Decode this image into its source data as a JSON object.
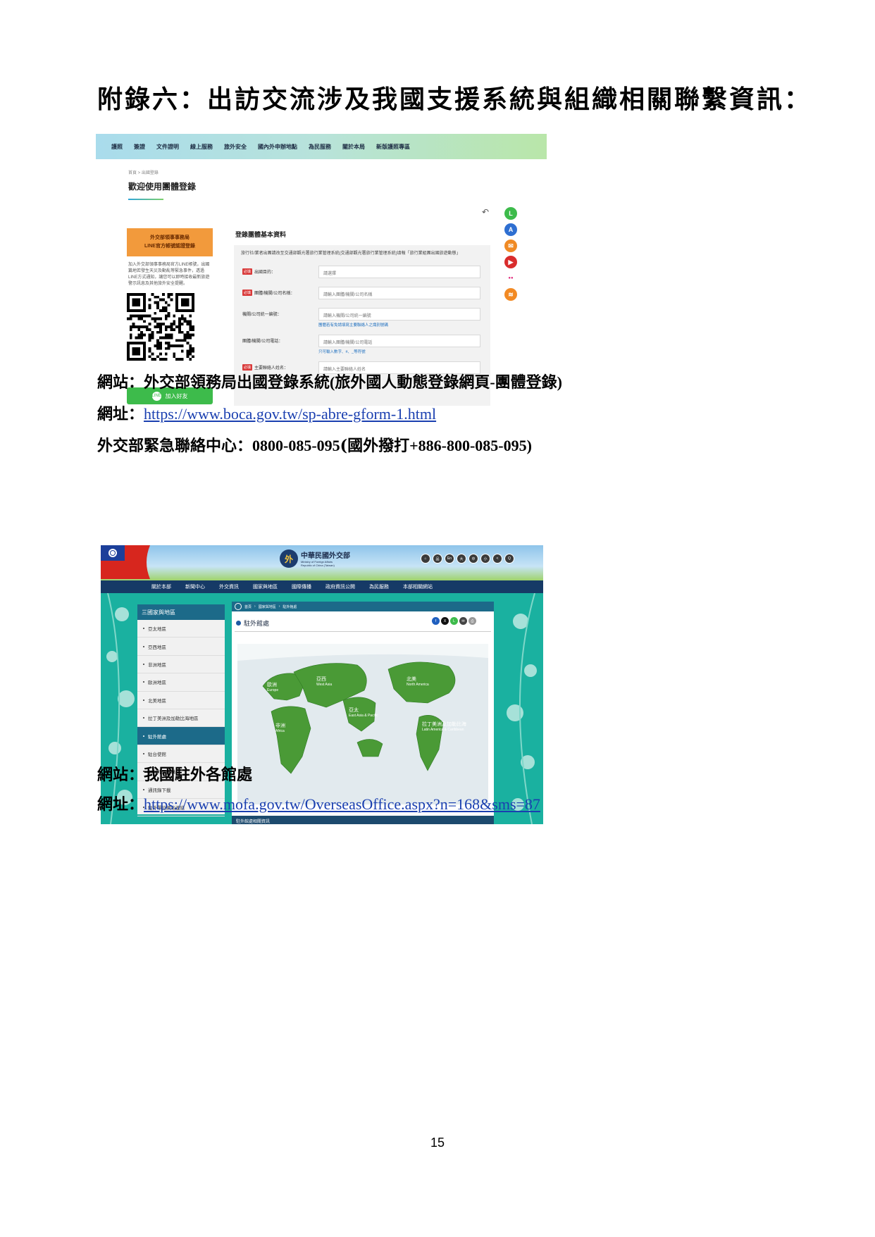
{
  "heading": "附錄六：出訪交流涉及我國支援系統與組織相關聯繫資訊：",
  "screenshot1": {
    "nav": [
      "護照",
      "簽證",
      "文件證明",
      "線上服務",
      "旅外安全",
      "國內外申辦地點",
      "為民服務",
      "關於本局",
      "新版護照專區"
    ],
    "breadcrumb": "首頁 > 出國登錄",
    "title": "歡迎使用團體登錄",
    "orange_box": [
      "外交部領事事務局",
      "LINE官方帳號認證登錄"
    ],
    "desc": "加入外交部領事事務局官方LINE帳號，出國篇地若發生天災及動亂等緊急事件，透過LINE方式通知，讓您可以即時接收最新旅遊警示訊息及其他旅外安全提醒。",
    "line_button": "加入好友",
    "form_title": "登錄團體基本資料",
    "form_note": "旅行社/業者出團請改至交通部觀光署旅行業管理系統(交通部觀光署旅行業管理系統)填報「旅行業組團出國旅遊動態」",
    "required_tag": "必填",
    "rows": [
      {
        "label": "出國目的：",
        "required": true,
        "value": "請選擇",
        "hint": ""
      },
      {
        "label": "團體/機關/公司名稱：",
        "required": true,
        "value": "請輸入團體/機關/公司名稱",
        "hint": ""
      },
      {
        "label": "機關/公司統一編號：",
        "required": false,
        "value": "請輸入機關/公司統一編號",
        "hint": "團體若有免請填寫主要聯絡人之識別號碼"
      },
      {
        "label": "團體/機關/公司電話：",
        "required": false,
        "value": "請輸入團體/機關/公司電話",
        "hint": "只可輸入數字、#、_等符號"
      },
      {
        "label": "主要聯絡人姓名：",
        "required": true,
        "value": "請輸入主要聯絡人姓名",
        "hint": ""
      }
    ],
    "socials": [
      {
        "icon": "line-icon",
        "color": "#3dbb4b",
        "glyph": "L"
      },
      {
        "icon": "share-icon",
        "color": "#2e6fd1",
        "glyph": "A"
      },
      {
        "icon": "mail-icon",
        "color": "#f08a24",
        "glyph": "✉"
      },
      {
        "icon": "youtube-icon",
        "color": "#d92c2c",
        "glyph": "▶"
      },
      {
        "icon": "flickr-icon",
        "color": "#ffffff",
        "glyph": "●●"
      },
      {
        "icon": "rss-icon",
        "color": "#f28a24",
        "glyph": "≋"
      }
    ]
  },
  "caption1": {
    "label": "網站：",
    "text": "外交部領務局出國登錄系統",
    "paren": "(旅外國人動態登錄網頁-團體登錄)"
  },
  "url1": {
    "label": "網址：",
    "href": "https://www.boca.gov.tw/sp-abre-gform-1.html"
  },
  "emergency": {
    "label": "外交部緊急聯絡中心：",
    "number": "0800-085-095",
    "abroad_open": "(國外撥打",
    "abroad_number": "+886-800-085-095)"
  },
  "screenshot2": {
    "logo_zh": "中華民國外交部",
    "logo_en1": "Ministry of Foreign Affairs",
    "logo_en2": "Republic of China (Taiwan)",
    "top_icons": [
      "⌂",
      "品",
      "En",
      "大",
      "中",
      "小",
      "<",
      "Q"
    ],
    "nav": [
      "關於本部",
      "新聞中心",
      "外交資訊",
      "國家與地區",
      "國際傳播",
      "政府資訊公開",
      "為民服務",
      "本部相關網站"
    ],
    "side_title": "三國家與地區",
    "side_items": [
      "亞太地區",
      "亞西地區",
      "非洲地區",
      "歐洲地區",
      "北美地區",
      "拉丁美洲及加勒比海地區",
      "駐外館處",
      "駐台使館",
      "駐台外國機構",
      "通訊錄下載",
      "駐外單位網站連結"
    ],
    "side_active_index": 6,
    "breadcrumb": [
      "首頁",
      "國家與地區",
      "駐外館處"
    ],
    "page_title": "駐外館處",
    "map_labels": [
      {
        "zh": "亞西",
        "en": "West Asia"
      },
      {
        "zh": "歐洲",
        "en": "Europe"
      },
      {
        "zh": "非洲",
        "en": "Africa"
      },
      {
        "zh": "亞太",
        "en": "East Asia & Pacific"
      },
      {
        "zh": "北美",
        "en": "North America"
      },
      {
        "zh": "拉丁美洲及加勒比海",
        "en": "Latin America & Caribbean"
      }
    ],
    "bottom_bar": "駐外館處相關資訊"
  },
  "caption2": {
    "label": "網站：",
    "text": "我國駐外各館處"
  },
  "url2": {
    "label": "網址：",
    "href": "https://www.mofa.gov.tw/OverseasOffice.aspx?n=168&sms=87"
  },
  "page_number": "15"
}
